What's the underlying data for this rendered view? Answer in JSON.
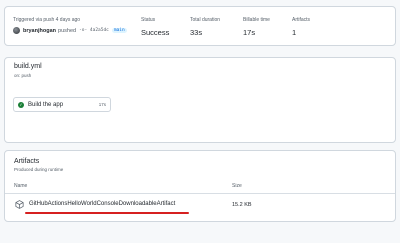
{
  "summary": {
    "trigger_label": "Triggered via push 4 days ago",
    "actor": "bryanjhogan",
    "action": "pushed",
    "commit_icon": "commit-icon",
    "commit_sha": "-o- 4a2a5dc",
    "branch": "main",
    "status_label": "Status",
    "status_value": "Success",
    "duration_label": "Total duration",
    "duration_value": "33s",
    "billable_label": "Billable time",
    "billable_value": "17s",
    "artifacts_label": "Artifacts",
    "artifacts_value": "1"
  },
  "workflow": {
    "file": "build.yml",
    "trigger": "on: push",
    "job": {
      "name": "Build the app",
      "duration": "17s",
      "status_icon": "check-circle-icon",
      "status_color": "#1a7f37"
    }
  },
  "artifacts": {
    "title": "Artifacts",
    "subtitle": "Produced during runtime",
    "col_name": "Name",
    "col_size": "Size",
    "items": [
      {
        "icon": "package-icon",
        "name": "GitHubActionsHelloWorldConsoleDownloadableArtifact",
        "size": "15.2 KB"
      }
    ],
    "annotation_color": "#d62020"
  }
}
